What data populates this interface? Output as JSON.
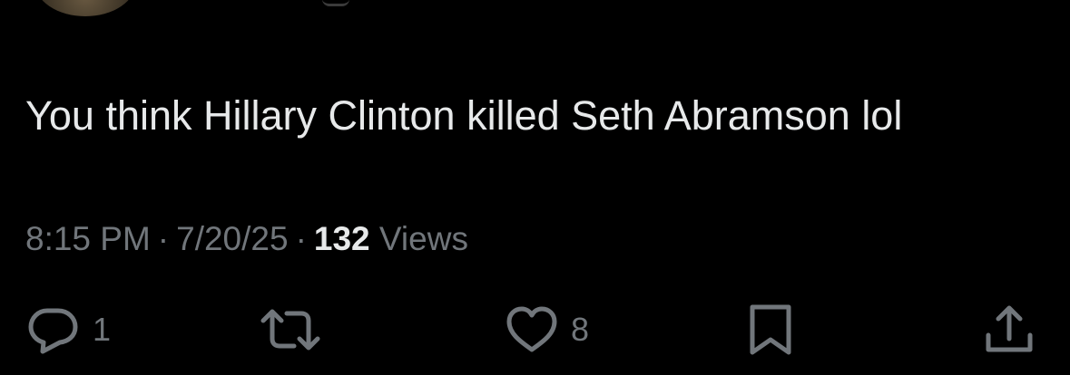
{
  "tweet": {
    "text": "You think Hillary Clinton killed Seth Abramson lol",
    "time": "8:15 PM",
    "separator": "·",
    "date": "7/20/25",
    "views_count": "132",
    "views_label": "Views"
  },
  "actions": {
    "reply_count": "1",
    "like_count": "8"
  },
  "colors": {
    "background": "#000000",
    "text_primary": "#e7e9ea",
    "text_secondary": "#71767b"
  },
  "icons": {
    "reply": "speech-bubble-icon",
    "repost": "repost-arrows-icon",
    "like": "heart-icon",
    "bookmark": "bookmark-icon",
    "share": "share-upload-icon"
  }
}
